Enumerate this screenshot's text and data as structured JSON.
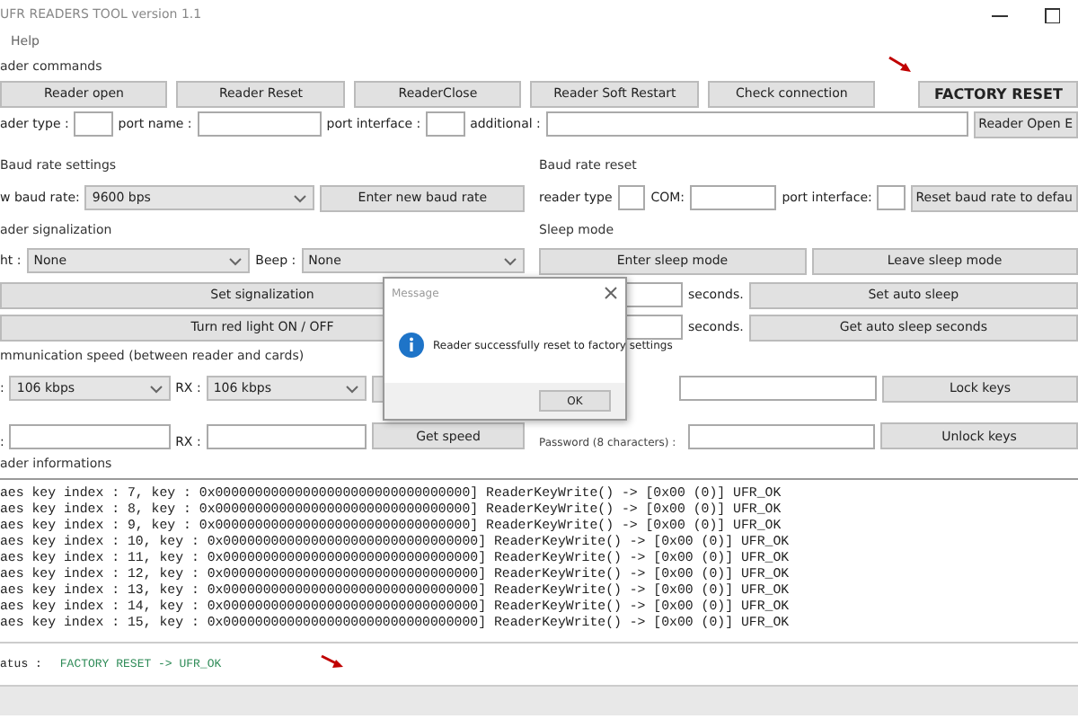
{
  "window": {
    "title": "UFR READERS TOOL version 1.1"
  },
  "menu": [
    "Help"
  ],
  "reader_commands": {
    "title": "ader commands",
    "buttons": [
      {
        "label": "Reader open",
        "kind": "normal"
      },
      {
        "label": "Reader Reset",
        "kind": "normal"
      },
      {
        "label": "ReaderClose",
        "kind": "normal"
      },
      {
        "label": "Reader Soft Restart",
        "kind": "normal"
      },
      {
        "label": "Check connection",
        "kind": "normal"
      },
      {
        "label": "FACTORY RESET",
        "kind": "bold"
      }
    ],
    "fields": [
      {
        "label": "ader type :"
      },
      {
        "label": "port name :"
      },
      {
        "label": "port interface :"
      },
      {
        "label": "additional :"
      }
    ],
    "open_button": "Reader Open E"
  },
  "baud_settings": {
    "title": "Baud rate settings",
    "label": "w baud rate:",
    "select": "9600 bps",
    "button": "Enter new baud rate"
  },
  "baud_reset": {
    "title": "Baud rate reset",
    "fields": [
      {
        "label": "reader type"
      },
      {
        "label": "COM:"
      },
      {
        "label": "port interface:"
      }
    ],
    "button": "Reset baud rate to defau"
  },
  "signalization": {
    "title": "ader signalization",
    "light_label": "ht :",
    "light": "None",
    "beep_label": "Beep :",
    "beep": "None",
    "buttons": [
      "Set signalization",
      "Turn red light ON / OFF"
    ]
  },
  "sleep_mode": {
    "title": "Sleep mode",
    "buttons": [
      "Enter sleep mode",
      "Leave sleep mode"
    ],
    "rows": [
      {
        "unit": "seconds.",
        "button": "Set auto sleep"
      },
      {
        "unit": "seconds.",
        "button": "Get auto sleep seconds"
      }
    ]
  },
  "speed": {
    "title": "mmunication speed (between reader and cards)",
    "rows": [
      {
        "label": ":",
        "value": "106 kbps",
        "rx_label": "RX :",
        "rx_value": "106 kbps",
        "kind": "select"
      },
      {
        "label": ":",
        "rx_label": "RX :",
        "button": "Get speed",
        "kind": "field"
      }
    ]
  },
  "keys": {
    "buttons": [
      "Lock keys",
      "Unlock keys"
    ],
    "password_label": "Password (8 characters) :"
  },
  "informations": {
    "title": "ader informations",
    "log": [
      "aes key index : 7, key : 0x00000000000000000000000000000000] ReaderKeyWrite()  ->  [0x00 (0)] UFR_OK",
      "aes key index : 8, key : 0x00000000000000000000000000000000] ReaderKeyWrite()  ->  [0x00 (0)] UFR_OK",
      "aes key index : 9, key : 0x00000000000000000000000000000000] ReaderKeyWrite()  ->  [0x00 (0)] UFR_OK",
      "aes key index : 10, key : 0x00000000000000000000000000000000] ReaderKeyWrite()  ->  [0x00 (0)] UFR_OK",
      "aes key index : 11, key : 0x00000000000000000000000000000000] ReaderKeyWrite()  ->  [0x00 (0)] UFR_OK",
      "aes key index : 12, key : 0x00000000000000000000000000000000] ReaderKeyWrite()  ->  [0x00 (0)] UFR_OK",
      "aes key index : 13, key : 0x00000000000000000000000000000000] ReaderKeyWrite()  ->  [0x00 (0)] UFR_OK",
      "aes key index : 14, key : 0x00000000000000000000000000000000] ReaderKeyWrite()  ->  [0x00 (0)] UFR_OK",
      "aes key index : 15, key : 0x00000000000000000000000000000000] ReaderKeyWrite()  ->  [0x00 (0)] UFR_OK"
    ]
  },
  "status": {
    "label": "atus :",
    "value": "FACTORY RESET -> UFR_OK"
  },
  "dialog": {
    "title": "Message",
    "message": "Reader successfully reset to factory settings",
    "button": "OK"
  }
}
